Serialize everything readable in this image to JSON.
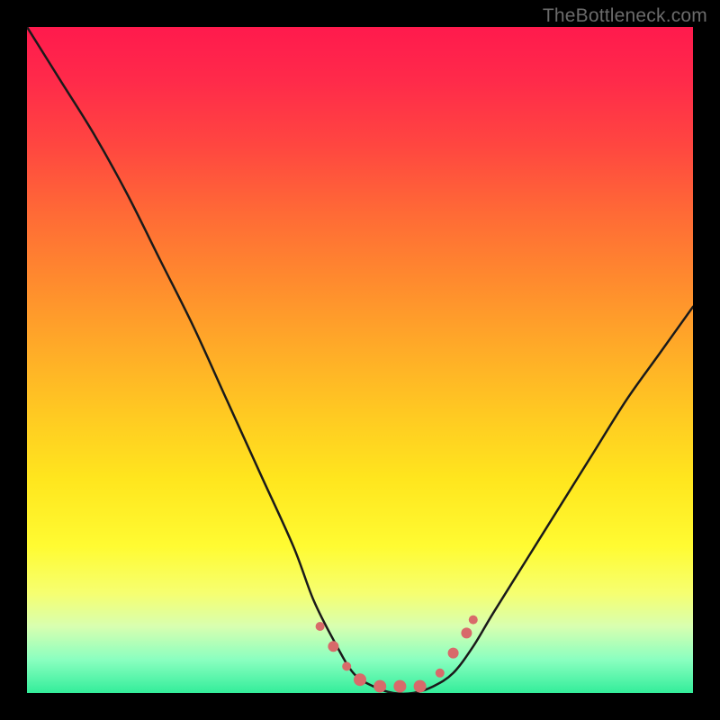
{
  "watermark": "TheBottleneck.com",
  "colors": {
    "gradient_top": "#ff1a4d",
    "gradient_bottom": "#33ed9a",
    "curve": "#1a1a1a",
    "marker": "#d86a6a",
    "frame": "#000000"
  },
  "chart_data": {
    "type": "line",
    "title": "",
    "xlabel": "",
    "ylabel": "",
    "xlim": [
      0,
      100
    ],
    "ylim": [
      0,
      100
    ],
    "grid": false,
    "legend": false,
    "annotations": [
      "TheBottleneck.com"
    ],
    "series": [
      {
        "name": "curve",
        "x": [
          0,
          5,
          10,
          15,
          20,
          25,
          30,
          35,
          40,
          43,
          46,
          49,
          52,
          55,
          58,
          61,
          64,
          67,
          70,
          75,
          80,
          85,
          90,
          95,
          100
        ],
        "y": [
          100,
          92,
          84,
          75,
          65,
          55,
          44,
          33,
          22,
          14,
          8,
          3,
          1,
          0,
          0,
          1,
          3,
          7,
          12,
          20,
          28,
          36,
          44,
          51,
          58
        ]
      }
    ],
    "markers": [
      {
        "x": 44,
        "y": 10,
        "r": 5
      },
      {
        "x": 46,
        "y": 7,
        "r": 6
      },
      {
        "x": 48,
        "y": 4,
        "r": 5
      },
      {
        "x": 50,
        "y": 2,
        "r": 7
      },
      {
        "x": 53,
        "y": 1,
        "r": 7
      },
      {
        "x": 56,
        "y": 1,
        "r": 7
      },
      {
        "x": 59,
        "y": 1,
        "r": 7
      },
      {
        "x": 62,
        "y": 3,
        "r": 5
      },
      {
        "x": 64,
        "y": 6,
        "r": 6
      },
      {
        "x": 66,
        "y": 9,
        "r": 6
      },
      {
        "x": 67,
        "y": 11,
        "r": 5
      }
    ]
  }
}
